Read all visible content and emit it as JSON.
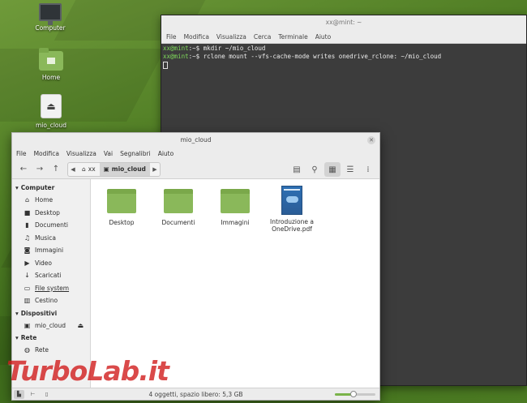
{
  "desktop": {
    "icons": [
      {
        "label": "Computer",
        "icon": "monitor-icon"
      },
      {
        "label": "Home",
        "icon": "home-folder-icon"
      },
      {
        "label": "mio_cloud",
        "icon": "drive-icon"
      }
    ],
    "watermark": "TurboLab.it"
  },
  "terminal": {
    "title": "xx@mint: ~",
    "menu": [
      "File",
      "Modifica",
      "Visualizza",
      "Cerca",
      "Terminale",
      "Aiuto"
    ],
    "lines": [
      {
        "prompt": "xx@mint",
        "rest": ":~$ mkdir ~/mio_cloud"
      },
      {
        "prompt": "xx@mint",
        "rest": ":~$ rclone mount --vfs-cache-mode writes onedrive_rclone: ~/mio_cloud"
      }
    ]
  },
  "file_manager": {
    "title": "mio_cloud",
    "menu": [
      "File",
      "Modifica",
      "Visualizza",
      "Vai",
      "Segnalibri",
      "Aiuto"
    ],
    "breadcrumbs": [
      {
        "label": "xx",
        "icon": "home-icon"
      },
      {
        "label": "mio_cloud",
        "icon": "drive-icon"
      }
    ],
    "sidebar": {
      "sections": [
        {
          "title": "Computer",
          "items": [
            {
              "label": "Home",
              "icon": "home-icon"
            },
            {
              "label": "Desktop",
              "icon": "desktop-icon"
            },
            {
              "label": "Documenti",
              "icon": "document-icon"
            },
            {
              "label": "Musica",
              "icon": "music-icon"
            },
            {
              "label": "Immagini",
              "icon": "camera-icon"
            },
            {
              "label": "Video",
              "icon": "video-icon"
            },
            {
              "label": "Scaricati",
              "icon": "download-icon"
            },
            {
              "label": "File system",
              "icon": "filesystem-icon"
            },
            {
              "label": "Cestino",
              "icon": "trash-icon"
            }
          ]
        },
        {
          "title": "Dispositivi",
          "items": [
            {
              "label": "mio_cloud",
              "icon": "drive-icon"
            }
          ]
        },
        {
          "title": "Rete",
          "items": [
            {
              "label": "Rete",
              "icon": "network-icon"
            }
          ]
        }
      ]
    },
    "files": [
      {
        "name": "Desktop",
        "type": "folder"
      },
      {
        "name": "Documenti",
        "type": "folder"
      },
      {
        "name": "Immagini",
        "type": "folder"
      },
      {
        "name": "Introduzione a OneDrive.pdf",
        "type": "pdf"
      }
    ],
    "status": "4 oggetti, spazio libero: 5,3 GB",
    "zoom_level": 0.45
  }
}
